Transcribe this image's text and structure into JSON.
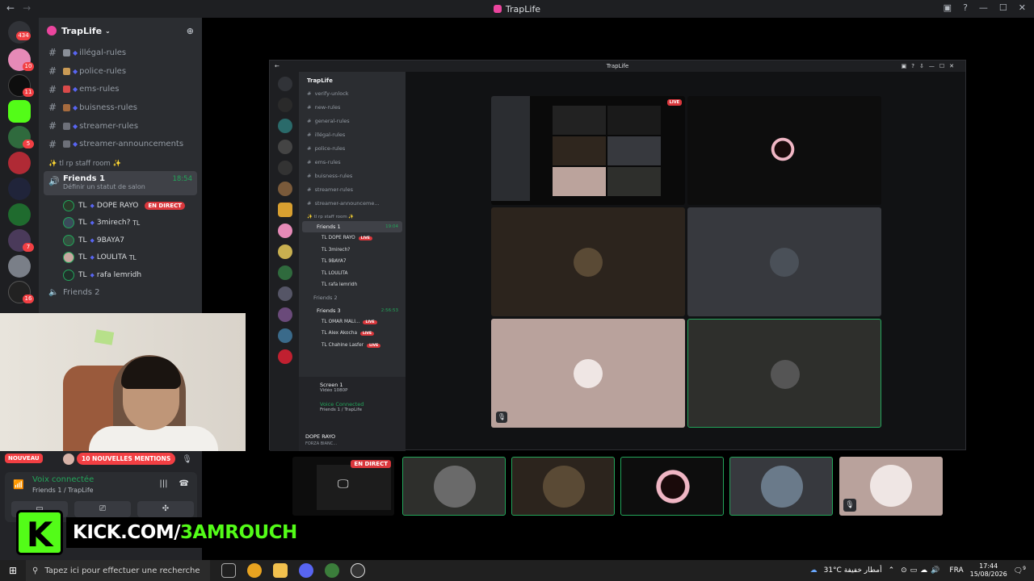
{
  "window": {
    "title": "TrapLife"
  },
  "rail": {
    "home_badge": "434",
    "badges": [
      "10",
      "11",
      "5",
      "7",
      "16"
    ]
  },
  "guild": {
    "name": "TrapLife"
  },
  "channels": [
    {
      "name": "illégal-rules",
      "color": "#8a8f98"
    },
    {
      "name": "police-rules",
      "color": "#c99a55"
    },
    {
      "name": "ems-rules",
      "color": "#d94a4a"
    },
    {
      "name": "buisness-rules",
      "color": "#a66b3e"
    },
    {
      "name": "streamer-rules",
      "color": "#6d7079"
    },
    {
      "name": "streamer-announcements",
      "color": "#6d7079"
    }
  ],
  "staff_category": "✨ tl rp staff room ✨",
  "voice_channel": {
    "name": "Friends 1",
    "status": "Définir un statut de salon",
    "timer": "18:54"
  },
  "members": [
    {
      "prefix": "TL",
      "name": "DOPE RAYO",
      "live": "EN DIRECT",
      "tag": "",
      "color": "#2a3a2a"
    },
    {
      "prefix": "TL",
      "name": "3mirech?",
      "live": "",
      "tag": "TL",
      "color": "#3a4a5a"
    },
    {
      "prefix": "TL",
      "name": "9BAYA7",
      "live": "",
      "tag": "",
      "color": "#345040"
    },
    {
      "prefix": "TL",
      "name": "LOULITA",
      "live": "",
      "tag": "TL",
      "color": "#c9a7a0"
    },
    {
      "prefix": "TL",
      "name": "rafa lemridh",
      "live": "",
      "tag": "",
      "color": "#20302a"
    }
  ],
  "idle_channel": "Friends 2",
  "bottom": {
    "nouveau": "NOUVEAU",
    "mentions": "10 NOUVELLES MENTIONS",
    "voice_title": "Voix connectée",
    "voice_sub": "Friends 1 / TrapLife"
  },
  "kick": {
    "logo": "K",
    "site": "KICK.COM/",
    "handle": "3AMROUCH",
    "brand_color": "#53fc18"
  },
  "inner": {
    "title": "TrapLife",
    "guild": "TrapLife",
    "channels": [
      "verify-unlock",
      "new-rules",
      "general-rules",
      "illégal-rules",
      "police-rules",
      "ems-rules",
      "buisness-rules",
      "streamer-rules",
      "streamer-announceme..."
    ],
    "category": "✨ tl rp staff room ✨",
    "vc1": {
      "name": "Friends 1",
      "timer": "19:04"
    },
    "members1": [
      {
        "name": "TL DOPE RAYO",
        "live": "LIVE"
      },
      {
        "name": "TL 3mirech?",
        "live": ""
      },
      {
        "name": "TL 9BAYA7",
        "live": ""
      },
      {
        "name": "TL LOULITA",
        "live": ""
      },
      {
        "name": "TL rafa lemridh",
        "live": ""
      }
    ],
    "vc2": "Friends 2",
    "vc3": {
      "name": "Friends 3",
      "timer": "2:56:53"
    },
    "members3": [
      {
        "name": "TL OMAR MALI...",
        "live": "LIVE"
      },
      {
        "name": "TL Alex Akocha",
        "live": "LIVE"
      },
      {
        "name": "TL Chahine Lasfer",
        "live": "LIVE"
      }
    ],
    "screen_title": "Screen 1",
    "screen_sub": "Vidéo 1080P",
    "voice_title": "Voice Connected",
    "voice_sub": "Friends 1 / TrapLife",
    "user": "DOPE RAYO",
    "user_sub": "FORZA BIANC...",
    "live_badge": "LIVE"
  },
  "strip": {
    "live_label": "EN DIRECT"
  },
  "taskbar": {
    "search_placeholder": "Tapez ici pour effectuer une recherche",
    "weather": "31°C أمطار خفيفة",
    "lang": "FRA",
    "time": "17:44",
    "date": "15/08/2026",
    "notif": "9"
  }
}
